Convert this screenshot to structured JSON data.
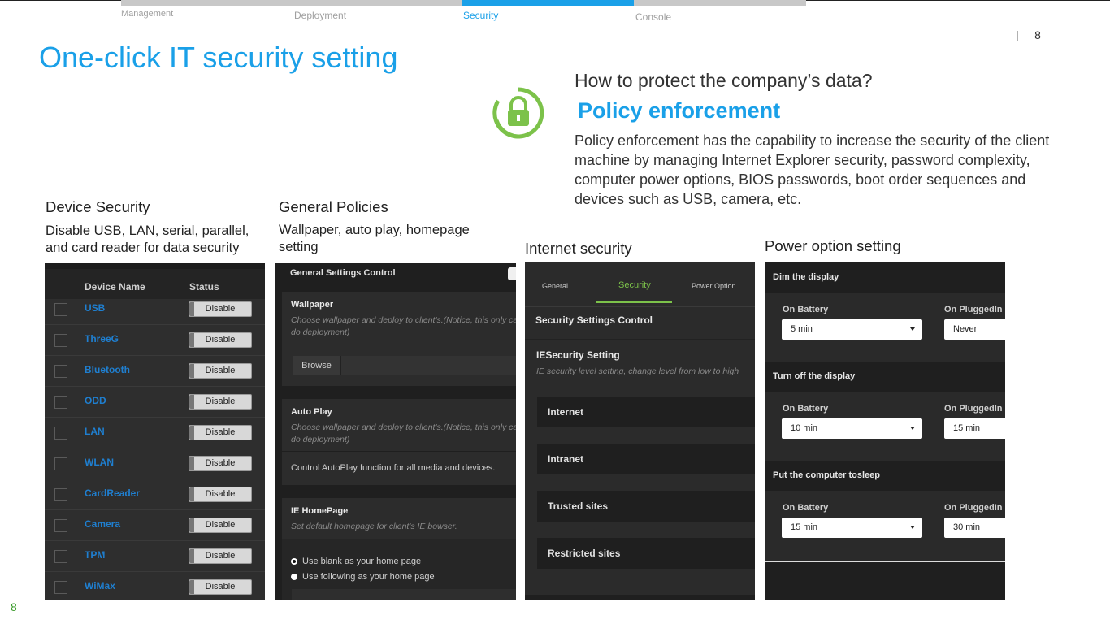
{
  "nav": {
    "tabs": [
      {
        "label": "Management"
      },
      {
        "label": "Deployment"
      },
      {
        "label": "Security"
      },
      {
        "label": "Console"
      }
    ],
    "active": "Security"
  },
  "page_number_top": "8",
  "page_number_bottom": "8",
  "title": "One-click IT security setting",
  "question": "How to protect the company’s data?",
  "policy_heading": "Policy enforcement",
  "policy_desc": "Policy enforcement has the capability to increase the security of the client machine by managing Internet Explorer security, password complexity, computer power options, BIOS passwords, boot order sequences and devices such as USB, camera, etc.",
  "sections": {
    "device": {
      "heading": "Device Security",
      "subtitle": "Disable USB, LAN, serial, parallel, and card reader for data security"
    },
    "general": {
      "heading": "General Policies",
      "subtitle": "Wallpaper, auto play, homepage setting"
    },
    "internet": {
      "heading": "Internet security"
    },
    "power": {
      "heading": "Power option setting"
    }
  },
  "device_panel": {
    "col_name": "Device Name",
    "col_status": "Status",
    "rows": [
      {
        "name": "USB",
        "status": "Disable"
      },
      {
        "name": "ThreeG",
        "status": "Disable"
      },
      {
        "name": "Bluetooth",
        "status": "Disable"
      },
      {
        "name": "ODD",
        "status": "Disable"
      },
      {
        "name": "LAN",
        "status": "Disable"
      },
      {
        "name": "WLAN",
        "status": "Disable"
      },
      {
        "name": "CardReader",
        "status": "Disable"
      },
      {
        "name": "Camera",
        "status": "Disable"
      },
      {
        "name": "TPM",
        "status": "Disable"
      },
      {
        "name": "WiMax",
        "status": "Disable"
      }
    ]
  },
  "general_panel": {
    "title": "General Settings Control",
    "wallpaper": {
      "heading": "Wallpaper",
      "hint": "Choose wallpaper and deploy to client's.(Notice, this only can to do deployment)",
      "browse": "Browse"
    },
    "autoplay": {
      "heading": "Auto Play",
      "hint": "Choose wallpaper and deploy to client's.(Notice, this only can to do deployment)",
      "text": "Control AutoPlay function for all media and devices."
    },
    "homepage": {
      "heading": "IE HomePage",
      "hint": "Set default homepage for client's IE bowser.",
      "option1": "Use blank as your home page",
      "option2": "Use following as your home page"
    }
  },
  "internet_panel": {
    "tabs": [
      "General",
      "Security",
      "Power Option"
    ],
    "active_tab": "Security",
    "control_title": "Security Settings Control",
    "ie_heading": "IESecurity Setting",
    "ie_hint": "IE security level setting, change level from low to high",
    "zones": [
      "Internet",
      "Intranet",
      "Trusted sites",
      "Restricted sites"
    ]
  },
  "power_panel": {
    "groups": [
      {
        "title": "Dim the display",
        "battery_label": "On Battery",
        "plugged_label": "On PluggedIn",
        "battery": "5 min",
        "plugged": "Never"
      },
      {
        "title": "Turn off the display",
        "battery_label": "On Battery",
        "plugged_label": "On PluggedIn",
        "battery": "10 min",
        "plugged": "15 min"
      },
      {
        "title": "Put the computer tosleep",
        "battery_label": "On Battery",
        "plugged_label": "On PluggedIn",
        "battery": "15 min",
        "plugged": "30 min"
      }
    ]
  },
  "colors": {
    "accent_blue": "#1aa0e8",
    "lock_green": "#7cc24a",
    "page_green": "#3a9a2a"
  }
}
